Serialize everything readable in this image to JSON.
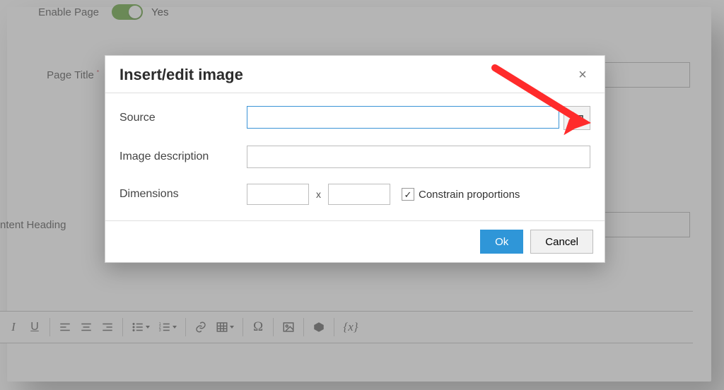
{
  "form": {
    "enable_page_label": "Enable Page",
    "enable_page_value": "Yes",
    "page_title_label": "Page Title",
    "content_heading_label": "ntent Heading"
  },
  "modal": {
    "title": "Insert/edit image",
    "source_label": "Source",
    "source_value": "",
    "desc_label": "Image description",
    "desc_value": "",
    "dim_label": "Dimensions",
    "dim_x": "x",
    "dim_w": "",
    "dim_h": "",
    "constrain_label": "Constrain proportions",
    "ok_label": "Ok",
    "cancel_label": "Cancel"
  },
  "toolbar": {
    "variable_glyph": "{x}"
  }
}
